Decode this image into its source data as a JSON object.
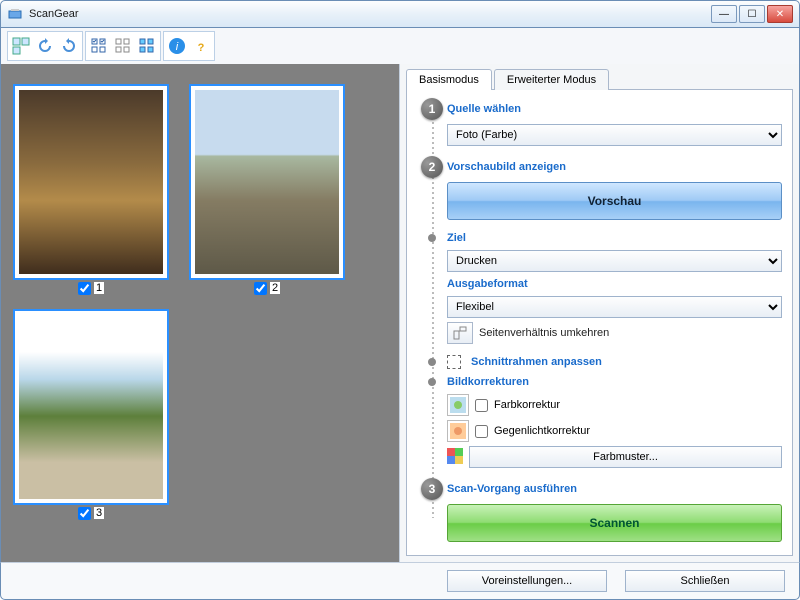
{
  "window": {
    "title": "ScanGear"
  },
  "thumbnails": [
    {
      "index": 1,
      "checked": true
    },
    {
      "index": 2,
      "checked": true
    },
    {
      "index": 3,
      "checked": true
    }
  ],
  "tabs": {
    "basic": "Basismodus",
    "advanced": "Erweiterter Modus",
    "active": "basic"
  },
  "step1": {
    "title": "Quelle wählen",
    "source_value": "Foto (Farbe)"
  },
  "step2": {
    "title": "Vorschaubild anzeigen",
    "preview_btn": "Vorschau",
    "target_label": "Ziel",
    "target_value": "Drucken",
    "outputfmt_label": "Ausgabeformat",
    "outputfmt_value": "Flexibel",
    "aspect_label": "Seitenverhältnis umkehren",
    "cropframe_label": "Schnittrahmen anpassen",
    "corrections_label": "Bildkorrekturen",
    "color_correction": "Farbkorrektur",
    "backlight_correction": "Gegenlichtkorrektur",
    "color_pattern_btn": "Farbmuster..."
  },
  "step3": {
    "title": "Scan-Vorgang ausführen",
    "scan_btn": "Scannen"
  },
  "bottom": {
    "preferences": "Voreinstellungen...",
    "close": "Schließen"
  }
}
